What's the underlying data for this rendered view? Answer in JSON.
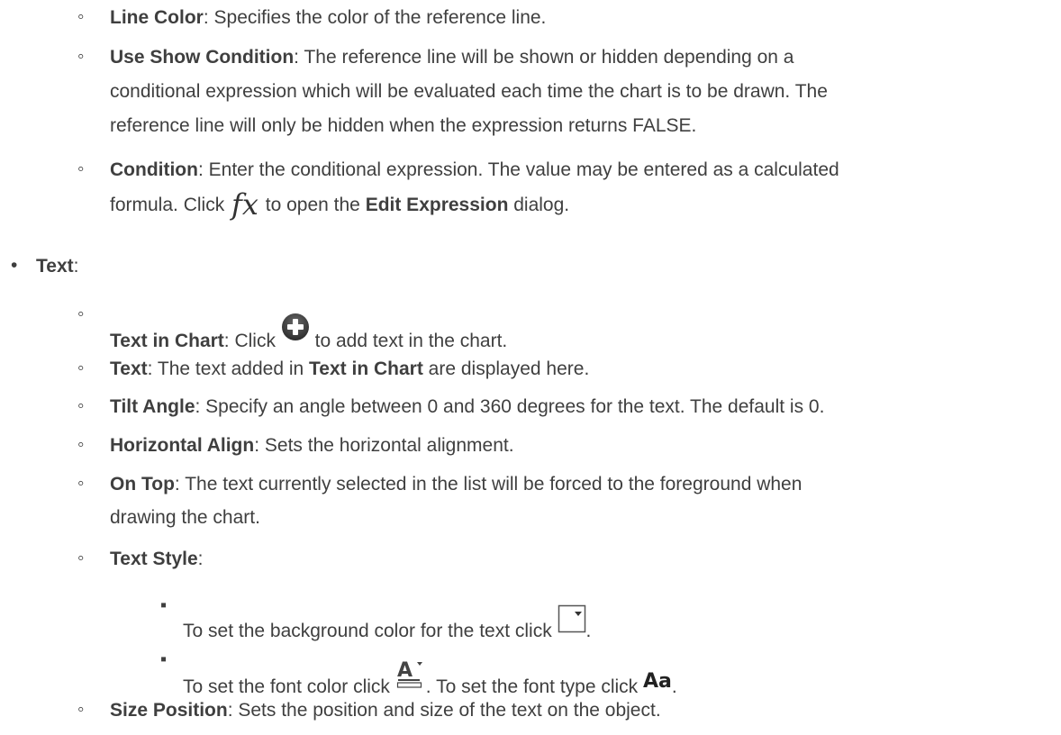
{
  "line_color": {
    "term": "Line Color",
    "desc": ": Specifies the color of the reference line."
  },
  "show_condition": {
    "term": "Use Show Condition",
    "desc_1": ": The reference line will be shown or hidden depending on a",
    "desc_2": "conditional expression which will be evaluated each time the chart is to be drawn. The",
    "desc_3": "reference line will only be hidden when the expression returns FALSE."
  },
  "condition": {
    "term": "Condition",
    "desc_1": ": Enter the conditional expression. The value may be entered as a calculated",
    "desc_2a": "formula. Click ",
    "fx_glyph": "fx",
    "desc_2b": " to open the ",
    "link_term": "Edit Expression",
    "desc_2c": " dialog."
  },
  "text_section": {
    "term": "Text",
    "colon": ":"
  },
  "text_in_chart": {
    "term": "Text in Chart",
    "desc_a": ": Click ",
    "desc_b": " to add text in the chart.",
    "icon": "plus-circle-icon"
  },
  "text_item": {
    "term": "Text",
    "desc_a": ": The text added in ",
    "ref_term": "Text in Chart",
    "desc_b": " are displayed here."
  },
  "tilt_angle": {
    "term": "Tilt Angle",
    "desc": ": Specify an angle between 0 and 360 degrees for the text. The default is 0."
  },
  "horizontal_align": {
    "term": "Horizontal Align",
    "desc": ": Sets the horizontal alignment."
  },
  "on_top": {
    "term": "On Top",
    "desc_1": ": The text currently selected in the list will be forced to the foreground when",
    "desc_2": "drawing the chart."
  },
  "text_style": {
    "term": "Text Style",
    "colon": ":",
    "bg_line": "To set the background color for the text click ",
    "bg_end": ".",
    "font_color_a": "To set the font color click ",
    "font_color_b": ". To set the font type click ",
    "font_type_glyph": "Aa",
    "font_end": "."
  },
  "size_position": {
    "term": "Size Position",
    "desc": ": Sets the position and size of the text on the object."
  },
  "markers": {
    "hollow": "◦",
    "filled": "•",
    "square": "▪"
  }
}
